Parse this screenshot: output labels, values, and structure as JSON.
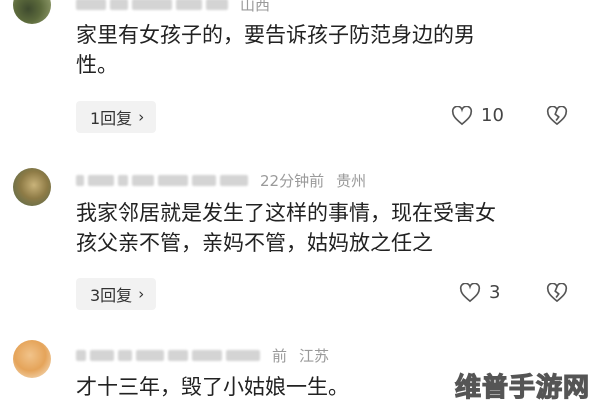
{
  "comments": [
    {
      "location": "山西",
      "time": "",
      "body_lines": [
        "家里有女孩子的，要告诉孩子防范身边的男",
        "性。"
      ],
      "reply_label": "1回复",
      "like_count": "10"
    },
    {
      "location": "贵州",
      "time": "22分钟前",
      "body_lines": [
        "我家邻居就是发生了这样的事情，现在受害女",
        "孩父亲不管，亲妈不管，姑妈放之任之"
      ],
      "reply_label": "3回复",
      "like_count": "3"
    },
    {
      "location": "江苏",
      "time": "前",
      "body_lines": [
        "才十三年，毁了小姑娘一生。"
      ],
      "reply_label": "",
      "like_count": ""
    }
  ],
  "icons": {
    "reply_chevron": "chevron-right-icon",
    "like": "heart-icon",
    "dislike": "broken-heart-icon"
  },
  "watermark": "维普手游网"
}
